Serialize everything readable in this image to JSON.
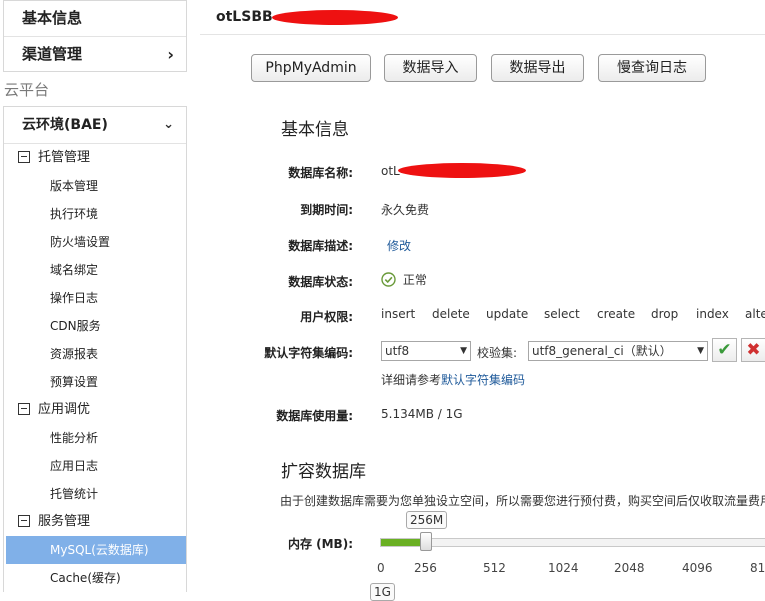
{
  "sidebar": {
    "top_items": [
      {
        "label": "基本信息"
      },
      {
        "label": "渠道管理"
      }
    ],
    "section_label": "云平台",
    "env": {
      "label": "云环境(BAE)"
    },
    "groups": [
      {
        "label": "托管管理",
        "items": [
          "版本管理",
          "执行环境",
          "防火墙设置",
          "域名绑定",
          "操作日志",
          "CDN服务",
          "资源报表",
          "预算设置"
        ]
      },
      {
        "label": "应用调优",
        "items": [
          "性能分析",
          "应用日志",
          "托管统计"
        ]
      },
      {
        "label": "服务管理",
        "items": [
          "MySQL(云数据库)",
          "Cache(缓存)"
        ]
      }
    ],
    "active_item": "MySQL(云数据库)"
  },
  "header": {
    "title": "otLSBB"
  },
  "toolbar": {
    "buttons": [
      "PhpMyAdmin",
      "数据导入",
      "数据导出",
      "慢查询日志"
    ]
  },
  "basic": {
    "heading": "基本信息",
    "db_name_label": "数据库名称:",
    "db_name_value": "otL",
    "expire_label": "到期时间:",
    "expire_value": "永久免费",
    "desc_label": "数据库描述:",
    "desc_link": "修改",
    "status_label": "数据库状态:",
    "status_value": "正常",
    "perm_label": "用户权限:",
    "permissions": [
      "insert",
      "delete",
      "update",
      "select",
      "create",
      "drop",
      "index",
      "alte"
    ],
    "charset_label": "默认字符集编码:",
    "charset_value": "utf8",
    "collation_label": "校验集:",
    "collation_value": "utf8_general_ci（默认）",
    "charset_hint_prefix": "详细请参考",
    "charset_hint_link": "默认字符集编码",
    "usage_label": "数据库使用量:",
    "usage_value": "5.134MB / 1G"
  },
  "expand": {
    "heading": "扩容数据库",
    "description": "由于创建数据库需要为您单独设立空间，所以需要您进行预付费，购买空间后仅收取流量费用",
    "memory_label": "内存 (MB):",
    "slider_value_label": "256M",
    "slider_ticks": [
      "0",
      "256",
      "512",
      "1024",
      "2048",
      "4096",
      "81"
    ],
    "selected_tick_index": 1,
    "bottom_label": "1G"
  },
  "colors": {
    "accent_active": "#80b0e8",
    "slider_fill": "#6ab023",
    "link": "#1f5a9a",
    "redaction": "#ee1111"
  }
}
